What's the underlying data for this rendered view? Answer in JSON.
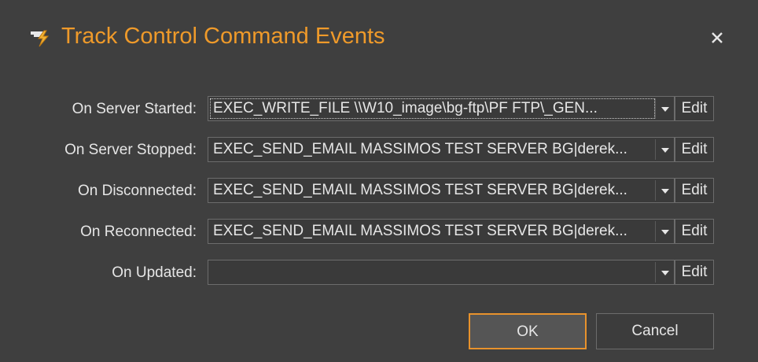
{
  "dialog": {
    "title": "Track Control Command Events",
    "title_icon": "lightning-script-icon",
    "close_icon": "close-icon",
    "accent_color": "#ef9a2a"
  },
  "rows": [
    {
      "label": "On Server Started:",
      "value": "EXEC_WRITE_FILE \\\\W10_image\\bg-ftp\\PF FTP\\_GEN...",
      "edit_label": "Edit"
    },
    {
      "label": "On Server Stopped:",
      "value": "EXEC_SEND_EMAIL MASSIMOS TEST SERVER BG|derek...",
      "edit_label": "Edit"
    },
    {
      "label": "On Disconnected:",
      "value": "EXEC_SEND_EMAIL MASSIMOS TEST SERVER BG|derek...",
      "edit_label": "Edit"
    },
    {
      "label": "On Reconnected:",
      "value": "EXEC_SEND_EMAIL MASSIMOS TEST SERVER BG|derek...",
      "edit_label": "Edit"
    },
    {
      "label": "On Updated:",
      "value": "",
      "edit_label": "Edit"
    }
  ],
  "buttons": {
    "ok_label": "OK",
    "cancel_label": "Cancel"
  }
}
